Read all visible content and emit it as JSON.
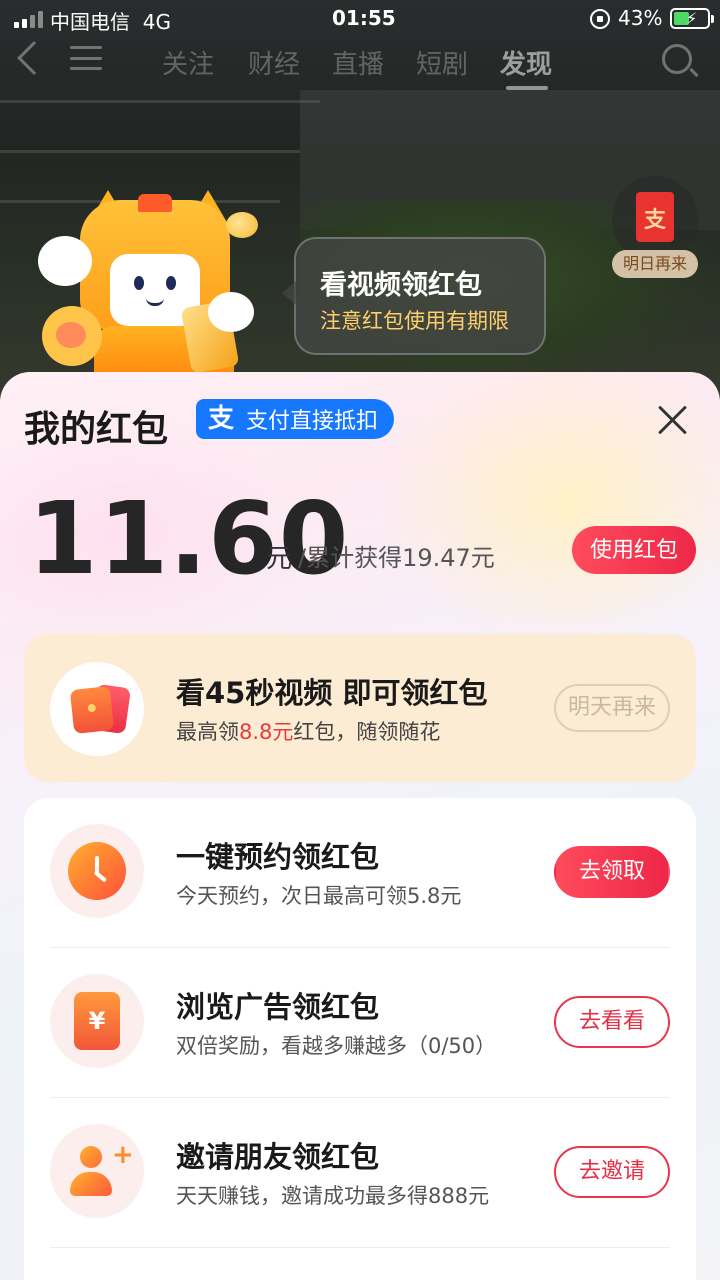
{
  "status_bar": {
    "carrier": "中国电信",
    "network": "4G",
    "time": "01:55",
    "battery": "43%"
  },
  "nav": {
    "tabs": [
      "关注",
      "财经",
      "直播",
      "短剧",
      "发现"
    ],
    "active_tab": "发现"
  },
  "floating_envelope": {
    "glyph": "支",
    "label": "明日再来"
  },
  "bubble": {
    "title": "看视频领红包",
    "subtitle": "注意红包使用有期限"
  },
  "sheet": {
    "title": "我的红包",
    "pay_badge": "支付直接抵扣",
    "pay_badge_glyph": "支",
    "amount": "11.60",
    "unit": "元",
    "total": "/累计获得19.47元",
    "use_button": "使用红包"
  },
  "video_task": {
    "title": "看45秒视频 即可领红包",
    "sub_prefix": "最高领",
    "sub_highlight": "8.8元",
    "sub_suffix": "红包，随领随花",
    "button": "明天再来"
  },
  "tasks": [
    {
      "title": "一键预约领红包",
      "sub": "今天预约，次日最高可领5.8元",
      "button": "去领取",
      "icon": "clock-icon"
    },
    {
      "title": "浏览广告领红包",
      "sub": "双倍奖励，看越多赚越多（0/50）",
      "button": "去看看",
      "icon": "yen-icon",
      "glyph": "¥"
    },
    {
      "title": "邀请朋友领红包",
      "sub": "天天赚钱，邀请成功最多得888元",
      "button": "去邀请",
      "icon": "add-friend-icon",
      "glyph": "+"
    }
  ],
  "colors": {
    "accent_red": "#ee2748",
    "alipay_blue": "#1677ff",
    "video_card_bg": "#fdecd4"
  }
}
